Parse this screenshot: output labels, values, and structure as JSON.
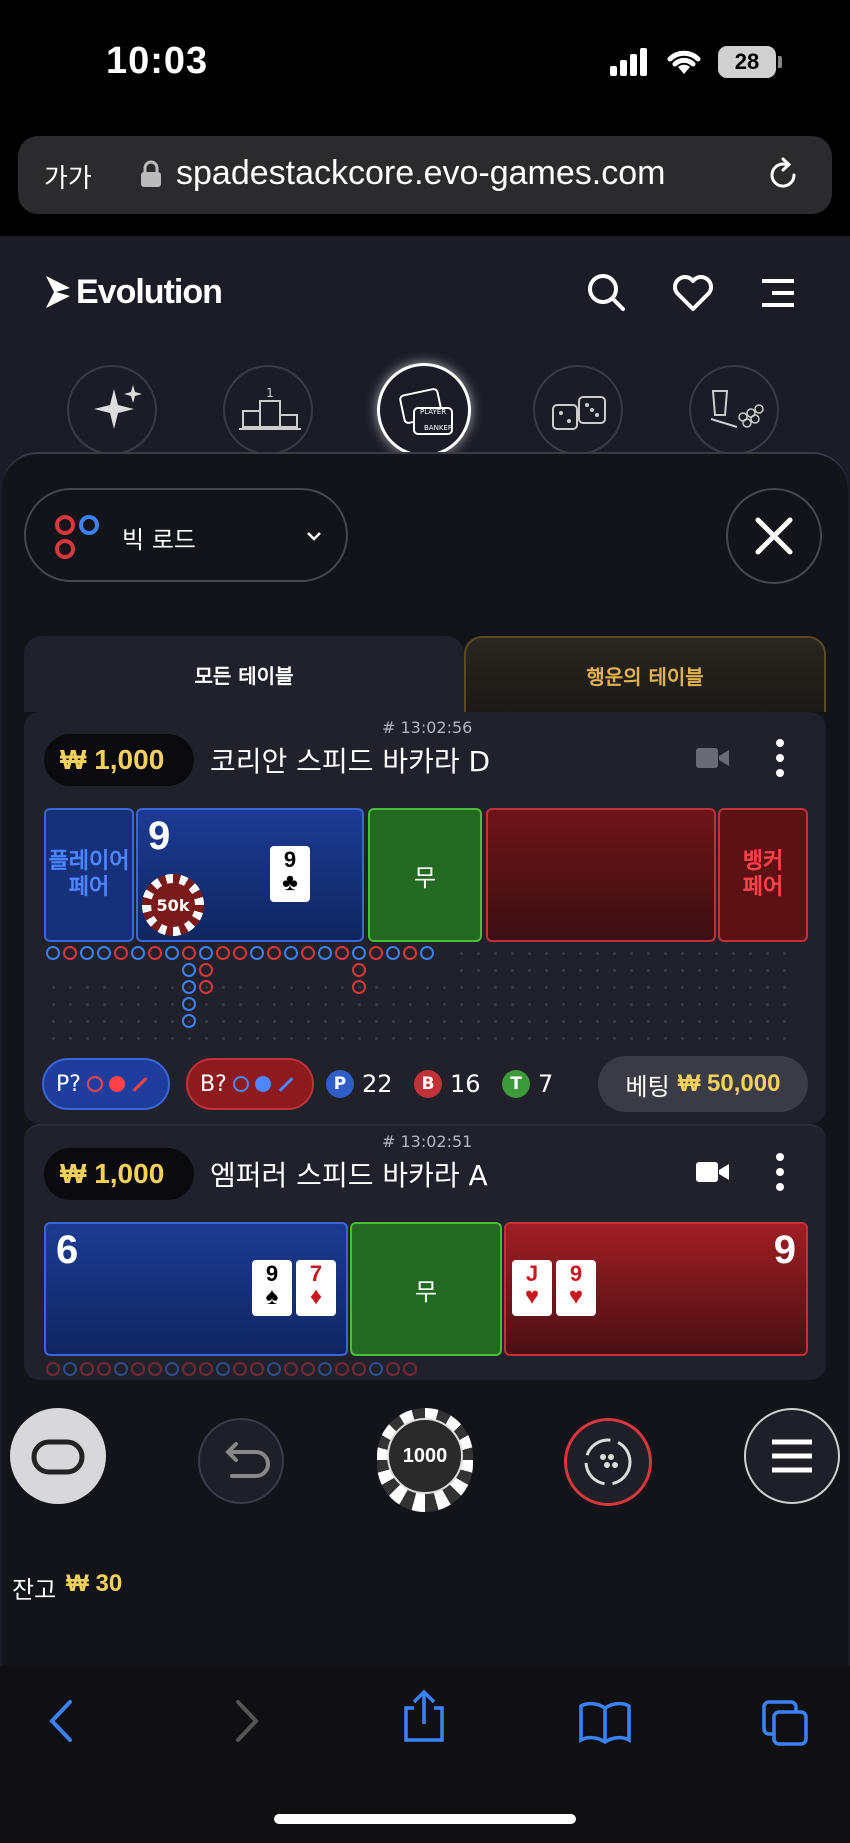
{
  "status_bar": {
    "time": "10:03",
    "battery": "28"
  },
  "browser": {
    "text_size": "가가",
    "url": "spadestackcore.evo-games.com"
  },
  "header": {
    "brand": "Evolution"
  },
  "filter": {
    "road_label": "빅 로드"
  },
  "tabs": {
    "all_tables": "모든 테이블",
    "lucky_tables": "행운의 테이블"
  },
  "tables": [
    {
      "timestamp": "# 13:02:56",
      "limit": "₩ 1,000",
      "name": "코리안 스피드 바카라 D",
      "player_pair": "플레이어\n페어",
      "player_score": "9",
      "player_card": {
        "rank": "9",
        "suit": "♣"
      },
      "bet_chip": "50k",
      "tie": "무",
      "banker_pair": "뱅커\n페어",
      "player_predict": "P?",
      "banker_predict": "B?",
      "p_label": "P",
      "p_count": "22",
      "b_label": "B",
      "b_count": "16",
      "t_label": "T",
      "t_count": "7",
      "bet_label": "베팅",
      "bet_amount": "₩ 50,000"
    },
    {
      "timestamp": "# 13:02:51",
      "limit": "₩ 1,000",
      "name": "엠퍼러 스피드 바카라 A",
      "player_score": "6",
      "player_cards": [
        {
          "rank": "9",
          "suit": "♠"
        },
        {
          "rank": "7",
          "suit": "♦"
        }
      ],
      "tie": "무",
      "banker_score": "9",
      "banker_cards": [
        {
          "rank": "J",
          "suit": "♥"
        },
        {
          "rank": "9",
          "suit": "♥"
        }
      ]
    }
  ],
  "controls": {
    "chip_value": "1000"
  },
  "balance": {
    "label": "잔고",
    "amount": "₩ 30"
  },
  "colors": {
    "gold": "#f3d15c",
    "player_blue": "#1b3a8f",
    "banker_red": "#8c1a1f",
    "tie_green": "#246a22"
  }
}
